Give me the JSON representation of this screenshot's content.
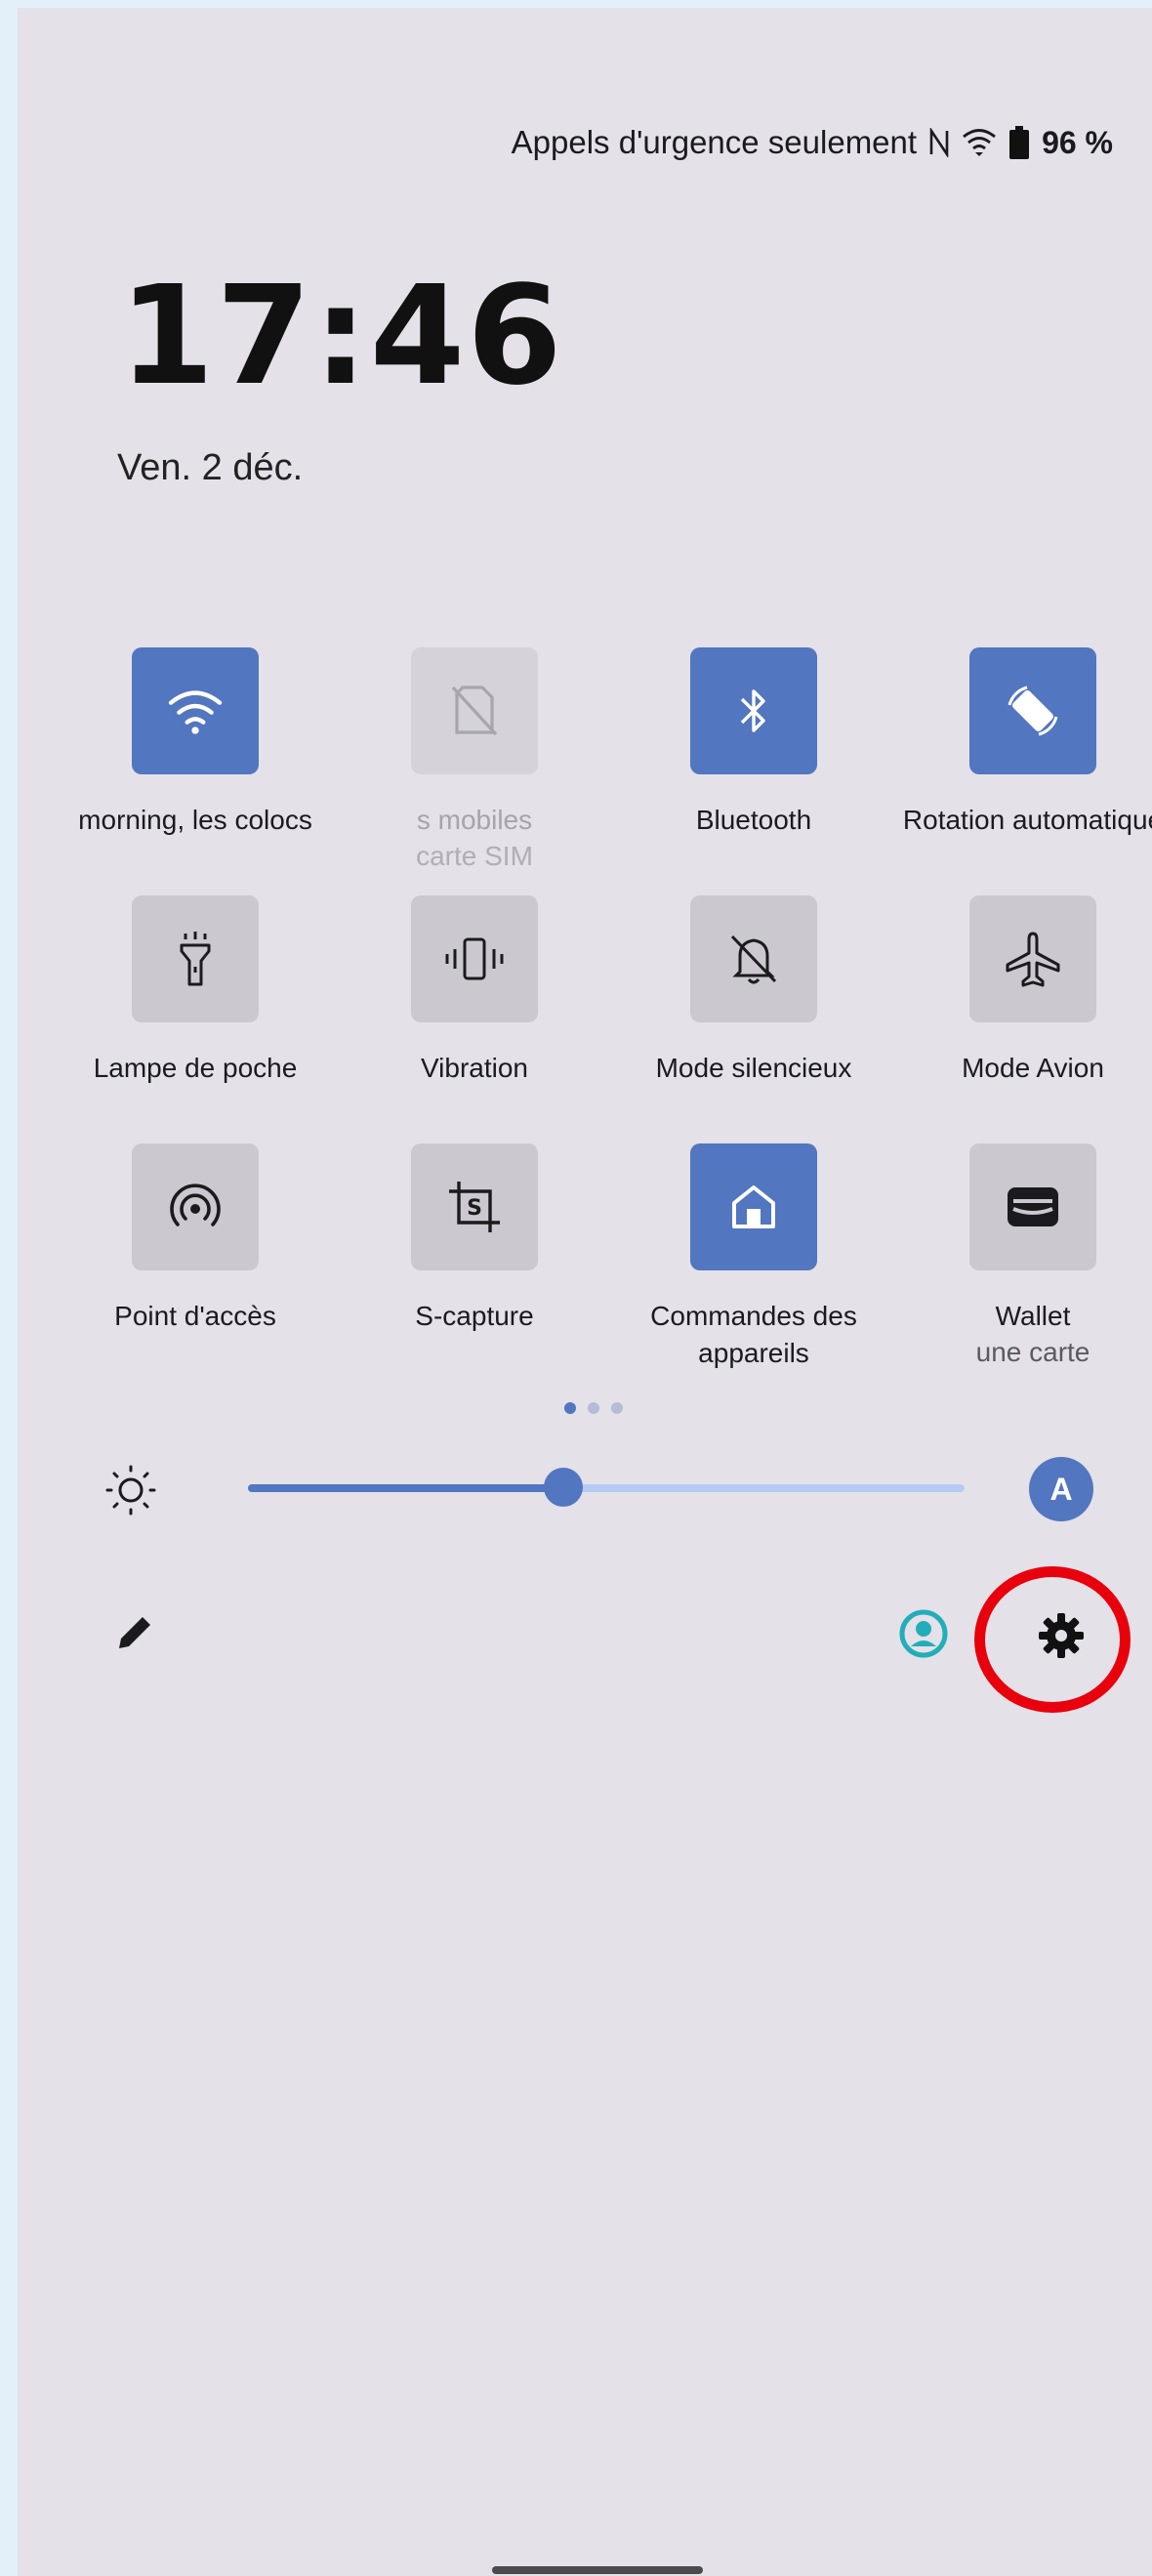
{
  "status_bar": {
    "carrier_text": "Appels d'urgence seulement",
    "battery_text": "96 %",
    "icons": [
      "nfc-icon",
      "wifi-icon",
      "battery-icon"
    ]
  },
  "lockscreen": {
    "time": "17:46",
    "date": "Ven. 2 déc."
  },
  "tiles": [
    {
      "label": "morning, les colocs",
      "icon": "wifi-icon",
      "state": "on"
    },
    {
      "label": "s mobiles",
      "sub": "carte SIM",
      "icon": "no-sim-icon",
      "state": "disabled"
    },
    {
      "label": "Bluetooth",
      "icon": "bluetooth-icon",
      "state": "on"
    },
    {
      "label": "Rotation automatique",
      "icon": "auto-rotate-icon",
      "state": "on"
    },
    {
      "label": "Lampe de poche",
      "icon": "flashlight-icon",
      "state": "off"
    },
    {
      "label": "Vibration",
      "icon": "vibrate-icon",
      "state": "off"
    },
    {
      "label": "Mode silencieux",
      "icon": "silent-bell-icon",
      "state": "off"
    },
    {
      "label": "Mode Avion",
      "icon": "airplane-icon",
      "state": "off"
    },
    {
      "label": "Point d'accès",
      "icon": "hotspot-icon",
      "state": "off"
    },
    {
      "label": "S-capture",
      "icon": "screen-capture-icon",
      "state": "off"
    },
    {
      "label": "Commandes des appareils",
      "icon": "home-icon",
      "state": "on"
    },
    {
      "label": "Wallet",
      "sub": "une carte",
      "icon": "wallet-icon",
      "state": "off"
    }
  ],
  "pager": {
    "pages": 3,
    "current": 1
  },
  "brightness": {
    "level": 0.44,
    "auto_label": "A"
  },
  "footer": {
    "edit_icon": "pencil-icon",
    "user_icon": "user-icon",
    "settings_icon": "gear-icon"
  },
  "colors": {
    "accent": "#5276bf",
    "panel": "#e4e1e8",
    "highlight": "#e8000c"
  }
}
